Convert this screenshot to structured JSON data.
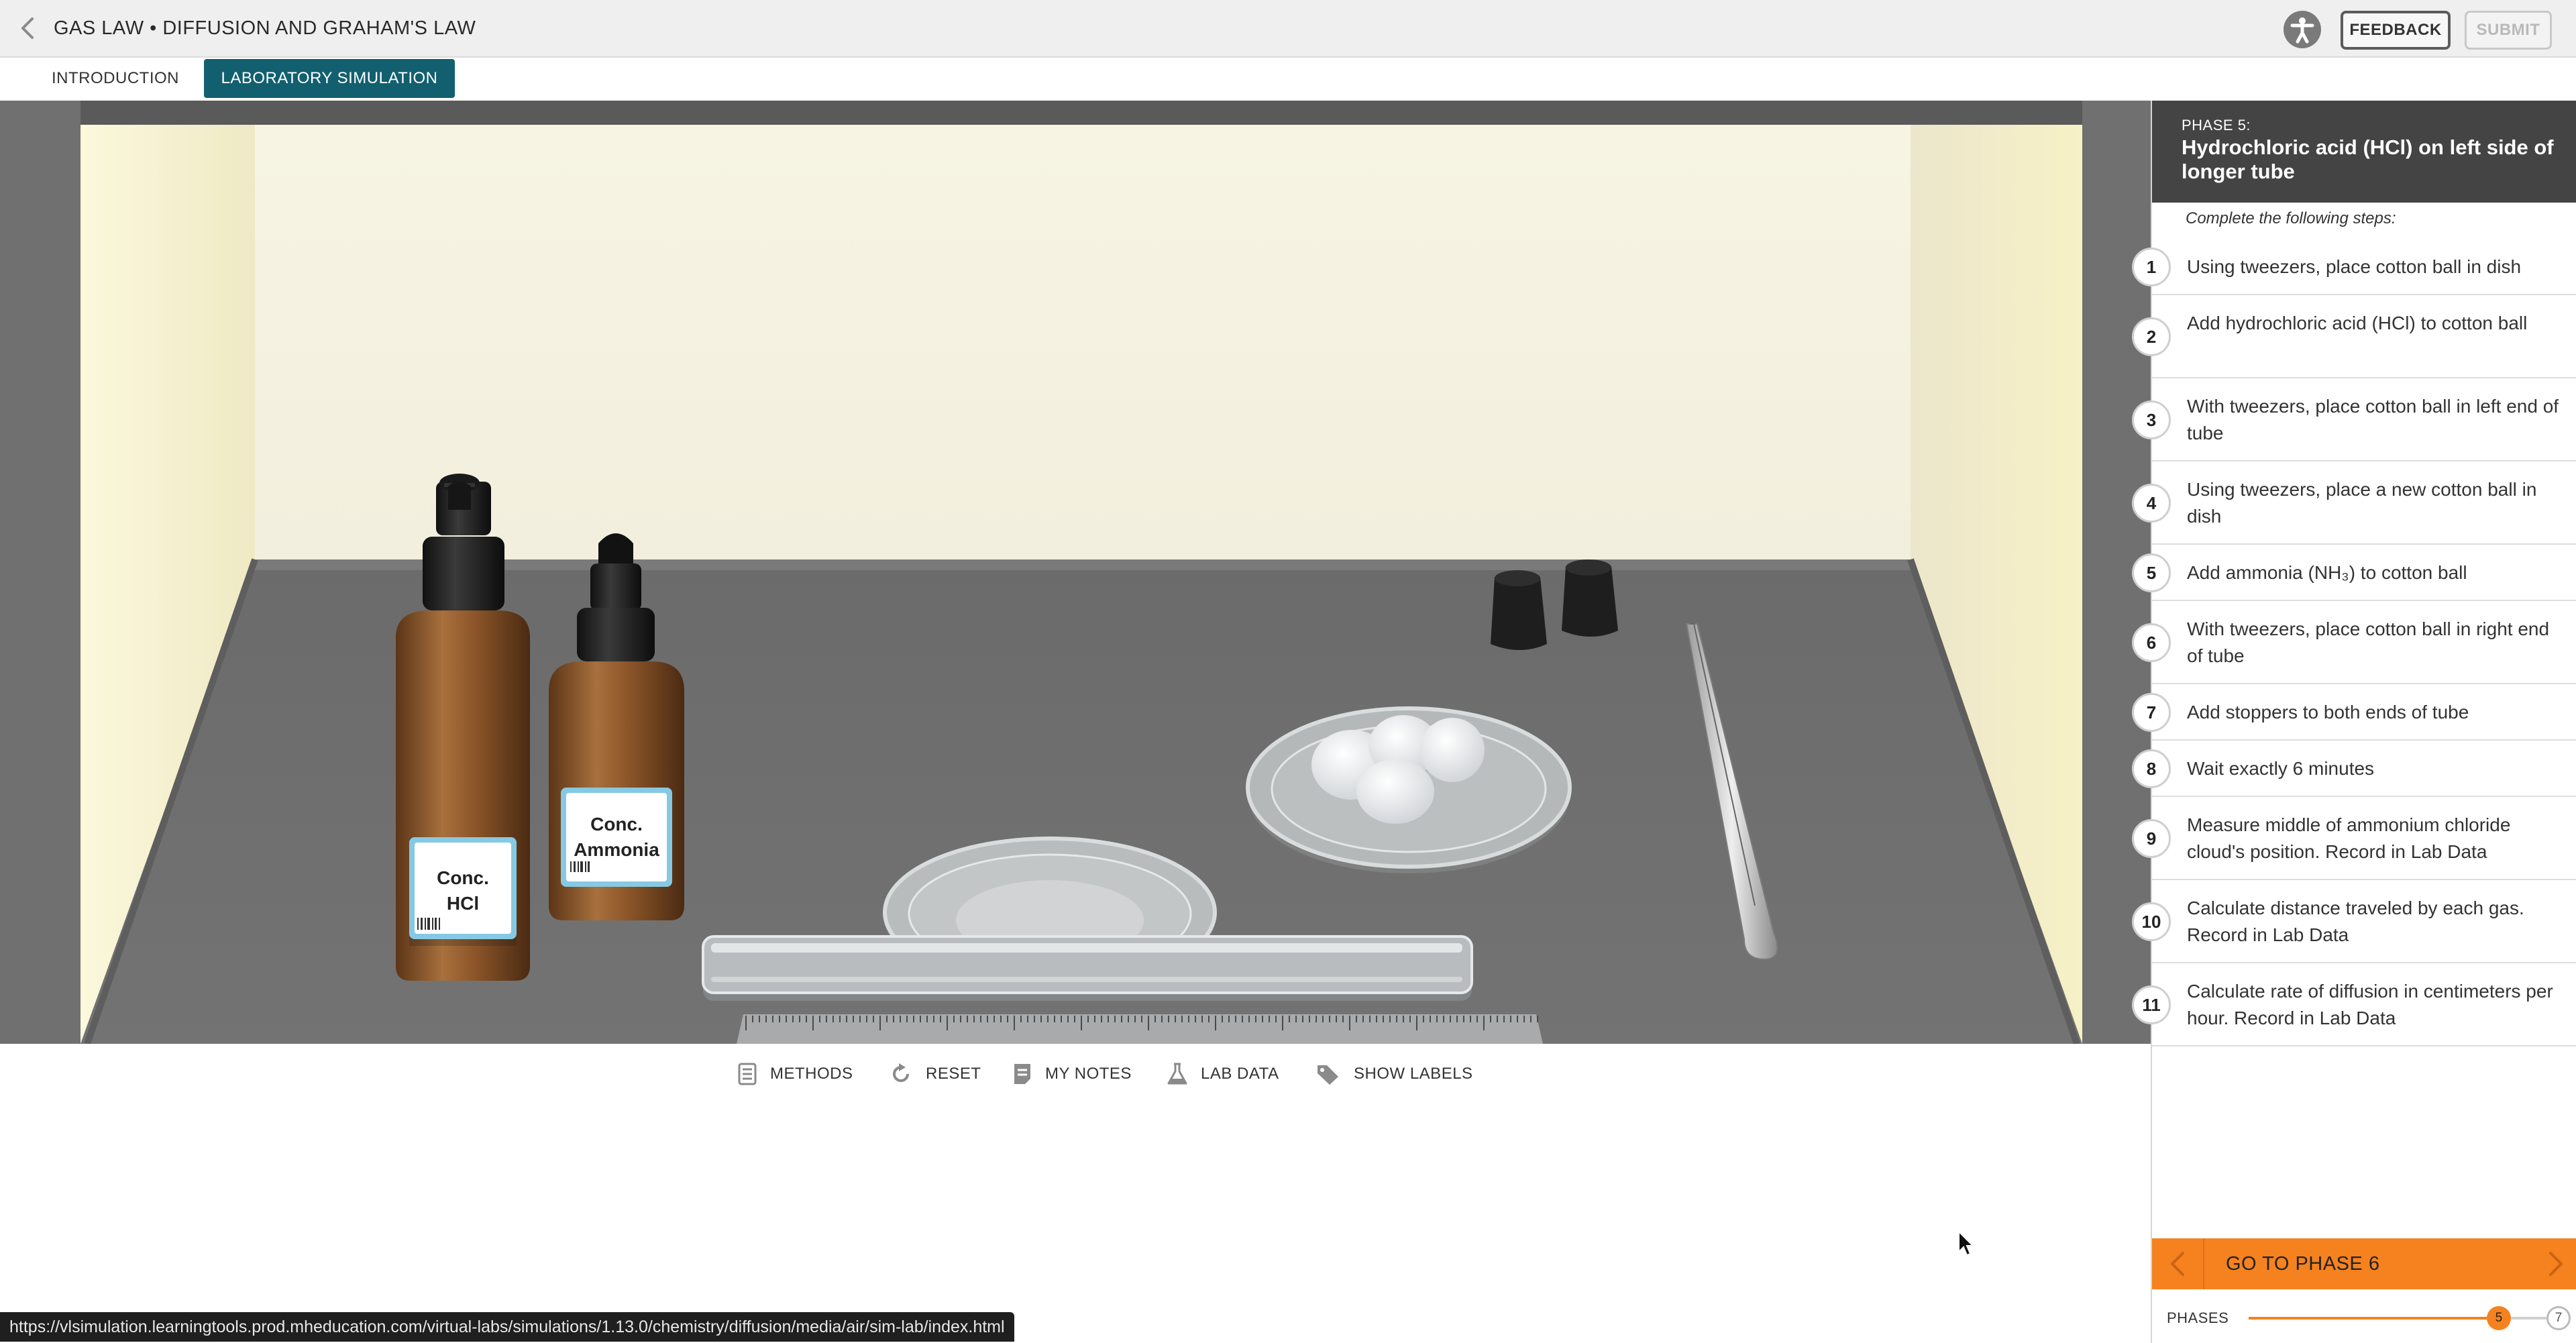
{
  "header": {
    "title": "GAS LAW • DIFFUSION AND GRAHAM'S LAW",
    "feedback_label": "FEEDBACK",
    "submit_label": "SUBMIT",
    "icons": [
      "chevron-left-icon",
      "accessibility-icon"
    ]
  },
  "tabs": [
    {
      "label": "INTRODUCTION",
      "active": false
    },
    {
      "label": "LABORATORY SIMULATION",
      "active": true
    }
  ],
  "scene": {
    "hcl_label_line1": "Conc.",
    "hcl_label_line2": "HCl",
    "ammonia_label_line1": "Conc.",
    "ammonia_label_line2": "Ammonia"
  },
  "toolbar": {
    "methods_label": "METHODS",
    "reset_label": "RESET",
    "notes_label": "MY NOTES",
    "labdata_label": "LAB DATA",
    "labels_label": "SHOW LABELS"
  },
  "panel": {
    "phase_label": "PHASE 5:",
    "phase_title": "Hydrochloric acid (HCl) on left side of longer tube",
    "steps_intro": "Complete the following steps:",
    "steps": [
      {
        "num": "1",
        "text": "Using tweezers, place cotton ball in dish"
      },
      {
        "num": "2",
        "text": "Add hydrochloric acid (HCl) to cotton ball"
      },
      {
        "num": "3",
        "text": "With tweezers, place cotton ball in left end of tube"
      },
      {
        "num": "4",
        "text": "Using tweezers, place a new cotton ball in dish"
      },
      {
        "num": "5",
        "text": "Add ammonia (NH₃) to cotton ball"
      },
      {
        "num": "6",
        "text": "With tweezers, place cotton ball in right end of tube"
      },
      {
        "num": "7",
        "text": "Add stoppers to both ends of tube"
      },
      {
        "num": "8",
        "text": "Wait exactly 6 minutes"
      },
      {
        "num": "9",
        "text": "Measure middle of ammonium chloride cloud's position. Record in Lab Data"
      },
      {
        "num": "10",
        "text": "Calculate distance traveled by each gas. Record in Lab Data"
      },
      {
        "num": "11",
        "text": "Calculate rate of diffusion in centimeters per hour. Record in Lab Data"
      }
    ],
    "go_label": "GO TO PHASE 6",
    "phases_label": "PHASES",
    "current_phase": "5",
    "total_phases": "7",
    "progress_fraction": 0.84
  },
  "status_url": "https://vlsimulation.learningtools.prod.mheducation.com/virtual-labs/simulations/1.13.0/chemistry/diffusion/media/air/sim-lab/index.html",
  "colors": {
    "accent_tab": "#125f6f",
    "phase_orange": "#f5821f",
    "phase_header": "#444444"
  }
}
